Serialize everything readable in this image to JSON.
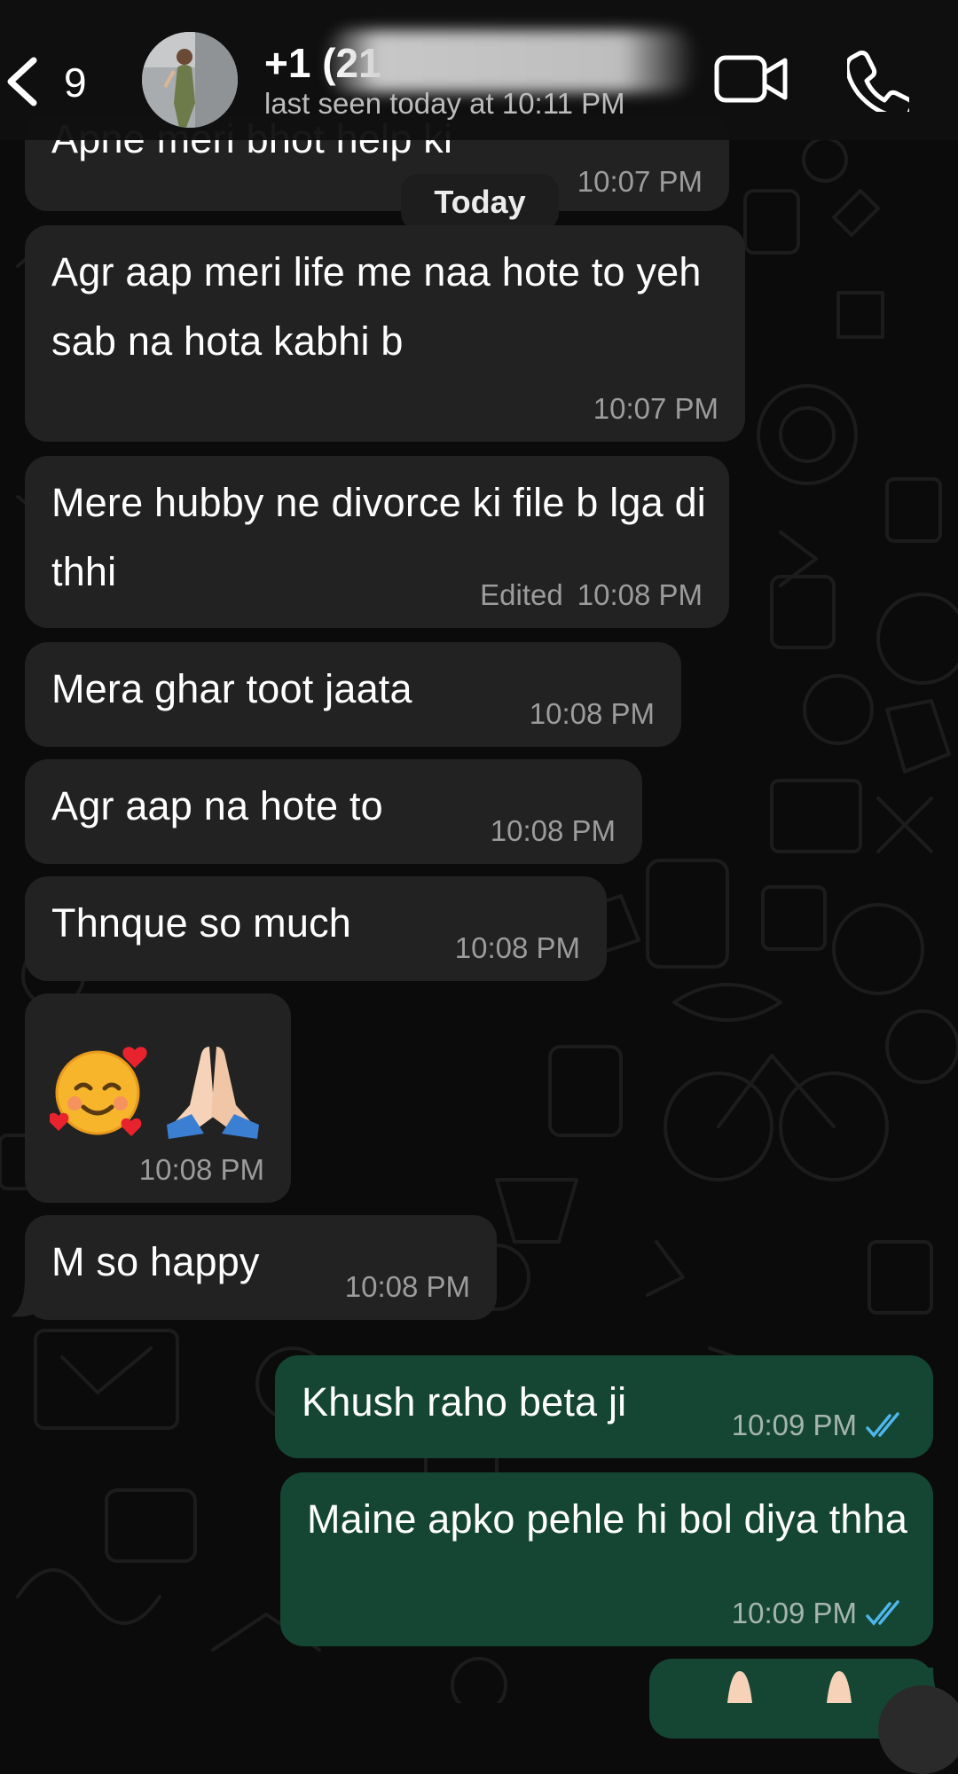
{
  "header": {
    "back_count": "9",
    "contact_name": "+1 (21",
    "last_seen": "last seen today at 10:11 PM"
  },
  "date_label": "Today",
  "messages": [
    {
      "dir": "in",
      "text": "Apne meri bhot help ki",
      "time": "10:07 PM"
    },
    {
      "dir": "in",
      "text": "Agr aap meri life me naa hote to yeh sab na hota kabhi b",
      "time": "10:07 PM"
    },
    {
      "dir": "in",
      "text": "Mere hubby ne divorce ki file b lga di thhi",
      "time": "10:08 PM",
      "edited": "Edited"
    },
    {
      "dir": "in",
      "text": "Mera ghar toot jaata",
      "time": "10:08 PM"
    },
    {
      "dir": "in",
      "text": "Agr aap na hote to",
      "time": "10:08 PM"
    },
    {
      "dir": "in",
      "text": "Thnque so much",
      "time": "10:08 PM"
    },
    {
      "dir": "in",
      "text": "",
      "emoji": [
        "smiling-face-with-hearts",
        "folded-hands"
      ],
      "time": "10:08 PM"
    },
    {
      "dir": "in",
      "text": "M so happy",
      "time": "10:08 PM"
    },
    {
      "dir": "out",
      "text": "Khush raho beta ji",
      "time": "10:09 PM",
      "status": "read"
    },
    {
      "dir": "out",
      "text": "Maine apko pehle hi bol diya thha",
      "time": "10:09 PM",
      "status": "read"
    }
  ],
  "colors": {
    "background": "#0b0b0b",
    "incoming_bubble": "#222222",
    "outgoing_bubble": "#144633",
    "read_ticks": "#4fb6ec"
  }
}
